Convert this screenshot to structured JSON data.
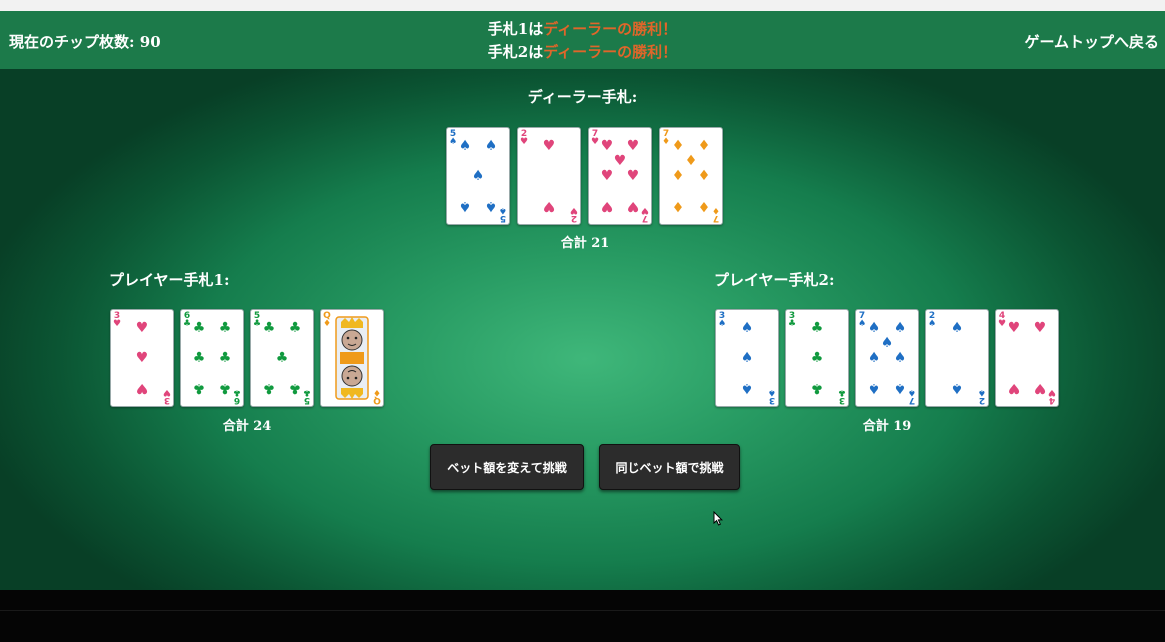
{
  "header": {
    "chips_label": "現在のチップ枚数: 90",
    "back_link": "ゲームトップへ戻る",
    "results": [
      {
        "hand_label": "手札1は",
        "outcome": "ディーラーの勝利！"
      },
      {
        "hand_label": "手札2は",
        "outcome": "ディーラーの勝利！"
      }
    ]
  },
  "dealer": {
    "title": "ディーラー手札:",
    "total": "合計 21",
    "cards": [
      {
        "rank": "5",
        "suit": "spade"
      },
      {
        "rank": "2",
        "suit": "heart"
      },
      {
        "rank": "7",
        "suit": "heart"
      },
      {
        "rank": "7",
        "suit": "diamond"
      }
    ]
  },
  "player_hands": [
    {
      "title": "プレイヤー手札1:",
      "total": "合計 24",
      "cards": [
        {
          "rank": "3",
          "suit": "heart"
        },
        {
          "rank": "6",
          "suit": "club"
        },
        {
          "rank": "5",
          "suit": "club"
        },
        {
          "rank": "Q",
          "suit": "diamond"
        }
      ]
    },
    {
      "title": "プレイヤー手札2:",
      "total": "合計 19",
      "cards": [
        {
          "rank": "3",
          "suit": "spade"
        },
        {
          "rank": "3",
          "suit": "club"
        },
        {
          "rank": "7",
          "suit": "spade"
        },
        {
          "rank": "2",
          "suit": "spade"
        },
        {
          "rank": "4",
          "suit": "heart"
        }
      ]
    }
  ],
  "buttons": {
    "change_bet": "ベット額を変えて挑戦",
    "same_bet": "同じベット額で挑戦"
  },
  "suit_colors": {
    "spade": "#1f6fc4",
    "heart": "#e0457b",
    "club": "#119a3f",
    "diamond": "#ef9a1a"
  }
}
